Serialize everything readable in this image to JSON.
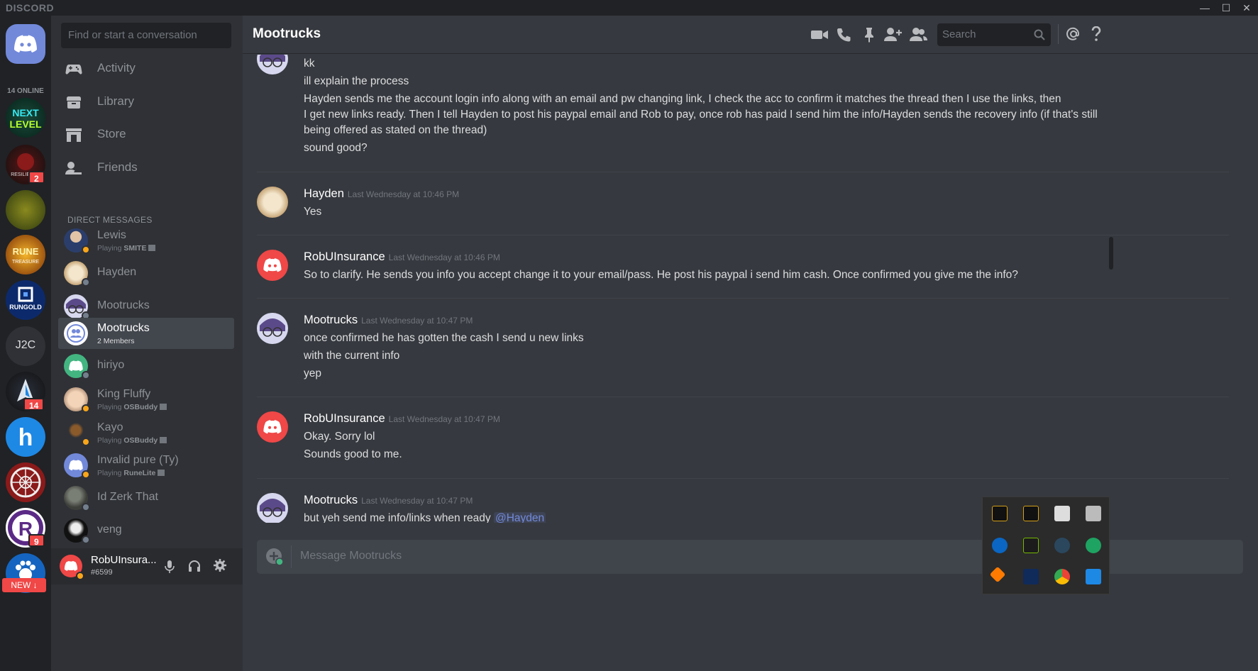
{
  "app": {
    "logo": "DISCORD"
  },
  "window_controls": {
    "minimize": "—",
    "maximize": "☐",
    "close": "✕"
  },
  "guilds": {
    "online_label": "14 ONLINE",
    "j2c_label": "J2C",
    "badge_resilience": "2",
    "badge_runelite": "14",
    "badge_r": "9",
    "new_button": "NEW ↓"
  },
  "sidebar": {
    "search_placeholder": "Find or start a conversation",
    "nav": [
      {
        "label": "Activity"
      },
      {
        "label": "Library"
      },
      {
        "label": "Store"
      },
      {
        "label": "Friends"
      }
    ],
    "dm_header": "DIRECT MESSAGES",
    "dms": [
      {
        "name": "Lewis",
        "sub_prefix": "Playing",
        "sub_game": "SMITE",
        "status": "#faa61a"
      },
      {
        "name": "Hayden",
        "status": "#747f8d"
      },
      {
        "name": "Mootrucks",
        "status": "#747f8d"
      },
      {
        "name": "Mootrucks",
        "sub_members": "2 Members"
      },
      {
        "name": "hiriyo",
        "status": "#747f8d"
      },
      {
        "name": "King Fluffy",
        "sub_prefix": "Playing",
        "sub_game": "OSBuddy",
        "status": "#faa61a"
      },
      {
        "name": "Kayo",
        "sub_prefix": "Playing",
        "sub_game": "OSBuddy",
        "status": "#faa61a"
      },
      {
        "name": "Invalid pure (Ty)",
        "sub_prefix": "Playing",
        "sub_game": "RuneLite",
        "status": "#faa61a"
      },
      {
        "name": "Id Zerk That",
        "status": "#747f8d"
      },
      {
        "name": "veng",
        "status": "#747f8d"
      }
    ]
  },
  "user_panel": {
    "username": "RobUInsura...",
    "tag": "#6599"
  },
  "channel": {
    "name": "Mootrucks",
    "search_placeholder": "Search"
  },
  "messages": [
    {
      "author": "",
      "timestamp": "",
      "lines": [
        "kk",
        "ill explain the process",
        "Hayden sends me the account login info along with an email and pw changing link, I check the acc to confirm it matches the thread then I use the links, then",
        "I get new links ready. Then I tell Hayden to post his paypal email and Rob to pay, once rob has paid I send him the info/Hayden sends the recovery info (if that's still",
        "being offered as stated on the thread)",
        "sound good?"
      ]
    },
    {
      "author": "Hayden",
      "timestamp": "Last Wednesday at 10:46 PM",
      "lines": [
        "Yes"
      ]
    },
    {
      "author": "RobUInsurance",
      "timestamp": "Last Wednesday at 10:46 PM",
      "lines": [
        "So to clarify. He sends you info you accept change it to your email/pass. He post his paypal i send him cash. Once confirmed you give me the info?"
      ]
    },
    {
      "author": "Mootrucks",
      "timestamp": "Last Wednesday at 10:47 PM",
      "lines": [
        "once confirmed he has gotten the cash I send u new links",
        "with the current info",
        "yep"
      ]
    },
    {
      "author": "RobUInsurance",
      "timestamp": "Last Wednesday at 10:47 PM",
      "lines": [
        "Okay. Sorry lol",
        "Sounds good to me."
      ]
    },
    {
      "author": "Mootrucks",
      "timestamp": "Last Wednesday at 10:47 PM",
      "lines": [
        "but yeh send me info/links when ready"
      ],
      "mention": "@Hayden"
    }
  ],
  "composer": {
    "placeholder": "Message Mootrucks"
  },
  "colors": {
    "blurple": "#7289da",
    "red": "#f04747",
    "idle": "#faa61a",
    "offline": "#747f8d"
  }
}
